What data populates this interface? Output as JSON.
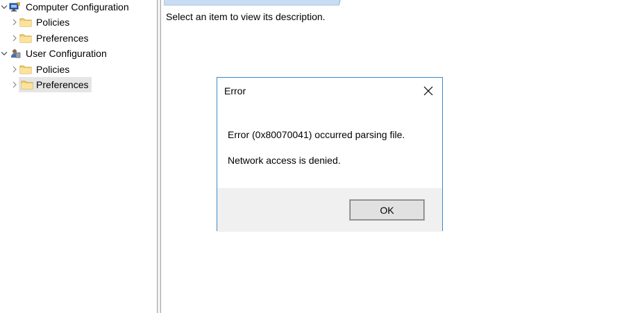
{
  "tree": {
    "items": [
      {
        "label": "Computer Configuration",
        "icon": "computer-config-icon",
        "level": 0,
        "expanded": true
      },
      {
        "label": "Policies",
        "icon": "folder-icon",
        "level": 1,
        "expanded": false
      },
      {
        "label": "Preferences",
        "icon": "folder-icon",
        "level": 1,
        "expanded": false
      },
      {
        "label": "User Configuration",
        "icon": "user-config-icon",
        "level": 0,
        "expanded": true
      },
      {
        "label": "Policies",
        "icon": "folder-icon",
        "level": 1,
        "expanded": false
      },
      {
        "label": "Preferences",
        "icon": "folder-icon",
        "level": 1,
        "expanded": false,
        "selected": true
      }
    ]
  },
  "right_pane": {
    "description": "Select an item to view its description."
  },
  "dialog": {
    "title": "Error",
    "message": "Error (0x80070041) occurred parsing file.",
    "detail": "Network access is denied.",
    "ok_label": "OK",
    "close_icon": "close-icon"
  },
  "colors": {
    "dialog_border": "#3c88c8",
    "dialog_footer": "#f0f0f0",
    "selection": "#e5e5e5",
    "folder": "#f5d36b"
  }
}
